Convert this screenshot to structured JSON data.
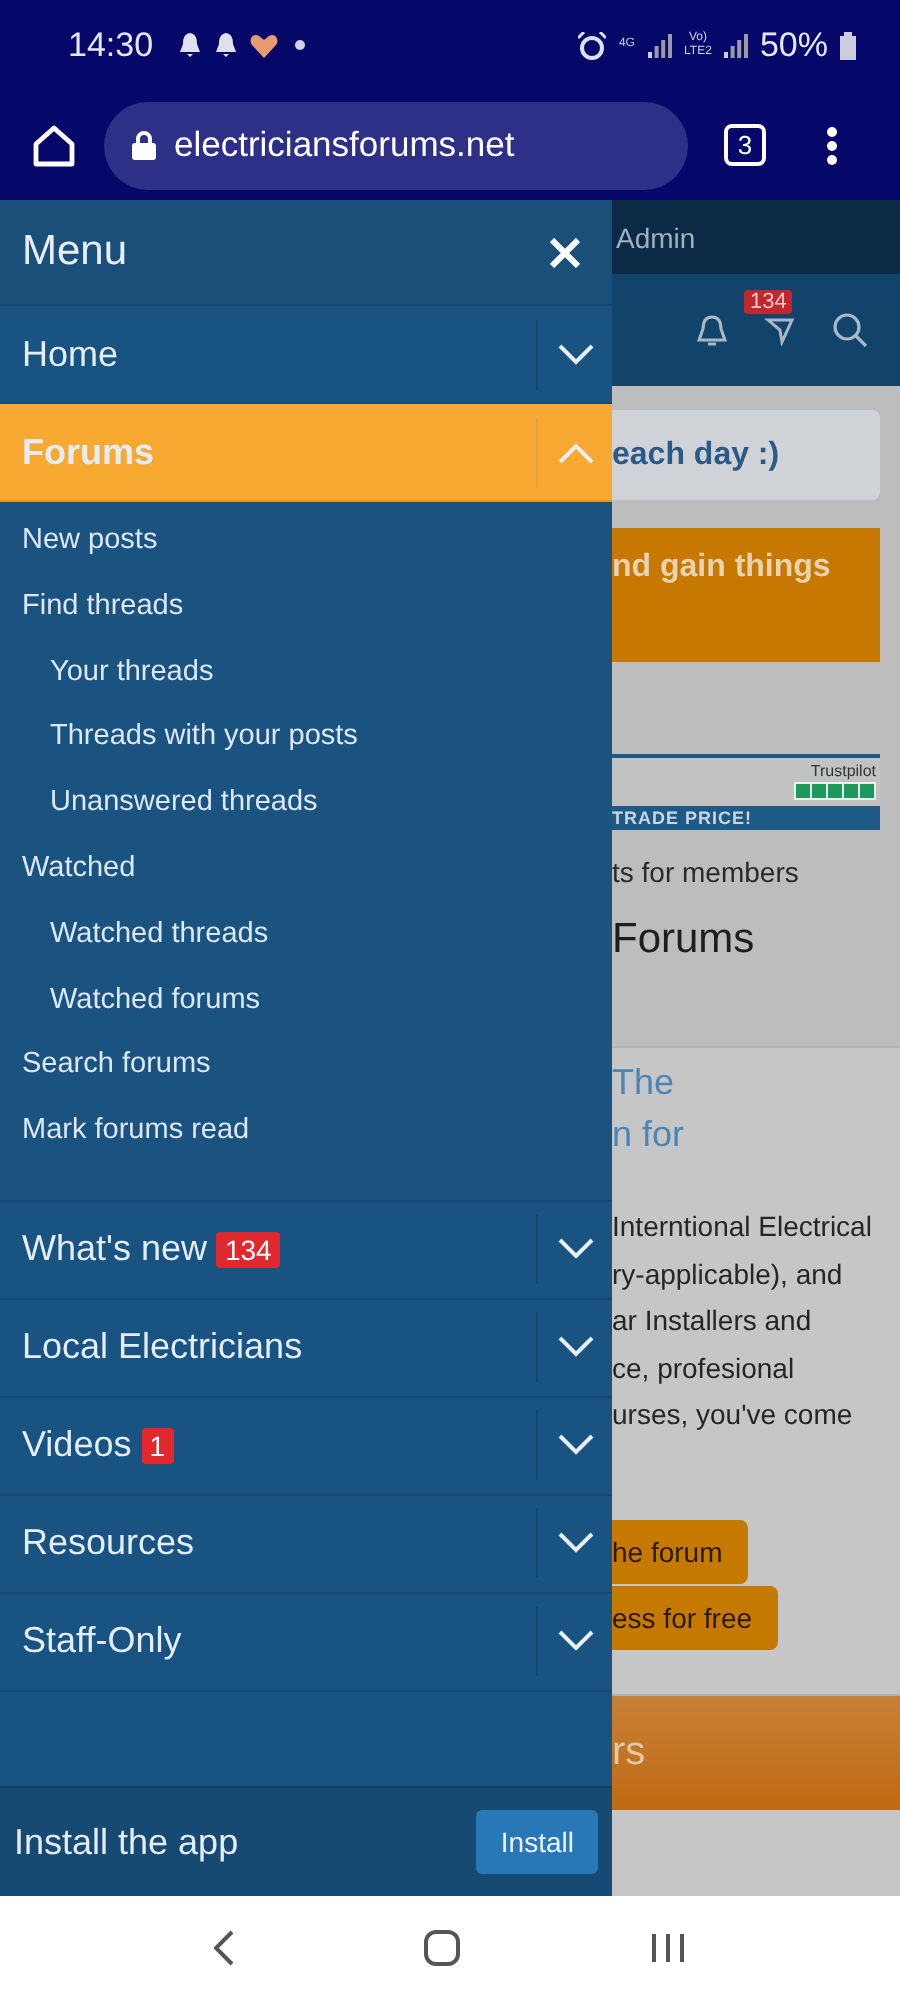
{
  "status_bar": {
    "time": "14:30",
    "signal_labels": [
      "4G",
      "Vo) LTE2"
    ],
    "battery": "50%"
  },
  "browser": {
    "url": "electriciansforums.net",
    "tab_count": "3"
  },
  "menu": {
    "title": "Menu",
    "items": [
      {
        "label": "Home",
        "expanded": false,
        "selected": false
      },
      {
        "label": "Forums",
        "expanded": true,
        "selected": true,
        "children": [
          {
            "label": "New posts"
          },
          {
            "label": "Find threads",
            "children": [
              {
                "label": "Your threads"
              },
              {
                "label": "Threads with your posts"
              },
              {
                "label": "Unanswered threads"
              }
            ]
          },
          {
            "label": "Watched",
            "children": [
              {
                "label": "Watched threads"
              },
              {
                "label": "Watched forums"
              }
            ]
          },
          {
            "label": "Search forums"
          },
          {
            "label": "Mark forums read"
          }
        ]
      },
      {
        "label": "What's new",
        "badge": "134",
        "expanded": false,
        "selected": false
      },
      {
        "label": "Local Electricians",
        "expanded": false,
        "selected": false
      },
      {
        "label": "Videos",
        "badge": "1",
        "expanded": false,
        "selected": false
      },
      {
        "label": "Resources",
        "expanded": false,
        "selected": false
      },
      {
        "label": "Staff-Only",
        "expanded": false,
        "selected": false
      }
    ]
  },
  "install_bar": {
    "text": "Install the app",
    "button": "Install"
  },
  "page": {
    "top_bar": "Admin",
    "alert_badge": "134",
    "notice": "each day :)",
    "promo": "nd gain things",
    "banner": {
      "rating_label": "Trustpilot",
      "stars": 5,
      "strip": "TRADE PRICE!"
    },
    "tagline": "ts for members",
    "heading": "Forums",
    "intro_title": [
      "The",
      "n for"
    ],
    "intro_lines": [
      "Interntional Electrical",
      "ry-applicable), and",
      "ar Installers and",
      "ce, profesional",
      "urses, you've come"
    ],
    "buttons": [
      "he forum",
      "ess for free"
    ],
    "footer_bar": "rs"
  }
}
